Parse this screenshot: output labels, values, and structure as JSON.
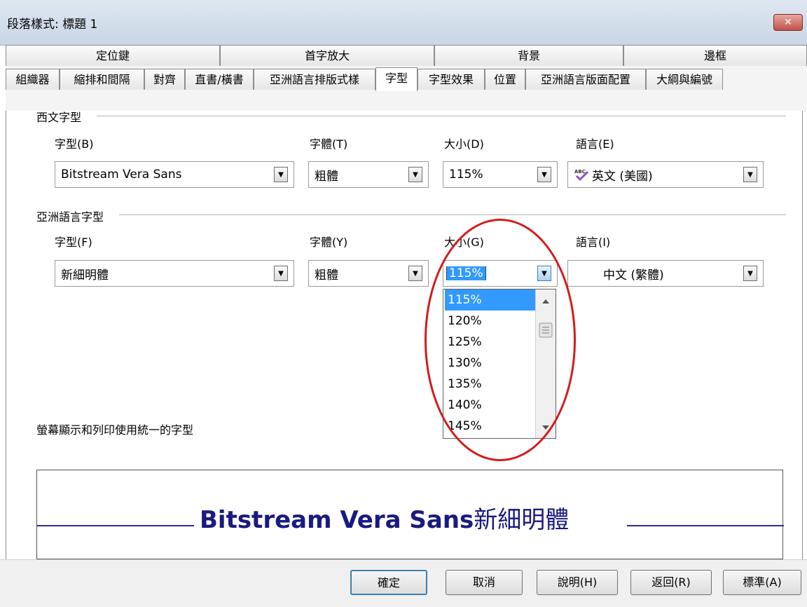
{
  "title": "段落樣式: 標題 1",
  "close_glyph": "✕",
  "tabs_row1": [
    "定位鍵",
    "首字放大",
    "背景",
    "邊框"
  ],
  "tabs_row2": [
    "組織器",
    "縮排和間隔",
    "對齊",
    "直書/橫書",
    "亞洲語言排版式樣",
    "字型",
    "字型效果",
    "位置",
    "亞洲語言版面配置",
    "大綱與編號"
  ],
  "western": {
    "header": "西文字型",
    "font_label": "字型(B)",
    "font_value": "Bitstream Vera Sans",
    "style_label": "字體(T)",
    "style_value": "粗體",
    "size_label": "大小(D)",
    "size_value": "115%",
    "lang_label": "語言(E)",
    "lang_value": "英文 (美國)"
  },
  "asian": {
    "header": "亞洲語言字型",
    "font_label": "字型(F)",
    "font_value": "新細明體",
    "style_label": "字體(Y)",
    "style_value": "粗體",
    "size_label": "大小(G)",
    "size_value": "115%",
    "lang_label": "語言(I)",
    "lang_value": "中文 (繁體)"
  },
  "size_options": [
    "115%",
    "120%",
    "125%",
    "130%",
    "135%",
    "140%",
    "145%"
  ],
  "uniform_note": "螢幕顯示和列印使用統一的字型",
  "preview": {
    "latin": "Bitstream Vera Sans",
    "cjk": "新細明體"
  },
  "buttons": {
    "ok": "確定",
    "cancel": "取消",
    "help": "說明(H)",
    "reset": "返回(R)",
    "standard": "標準(A)"
  },
  "colors": {
    "highlight": "#3399ff",
    "annotation": "#d21c1c",
    "preview_text": "#1a1a80"
  }
}
